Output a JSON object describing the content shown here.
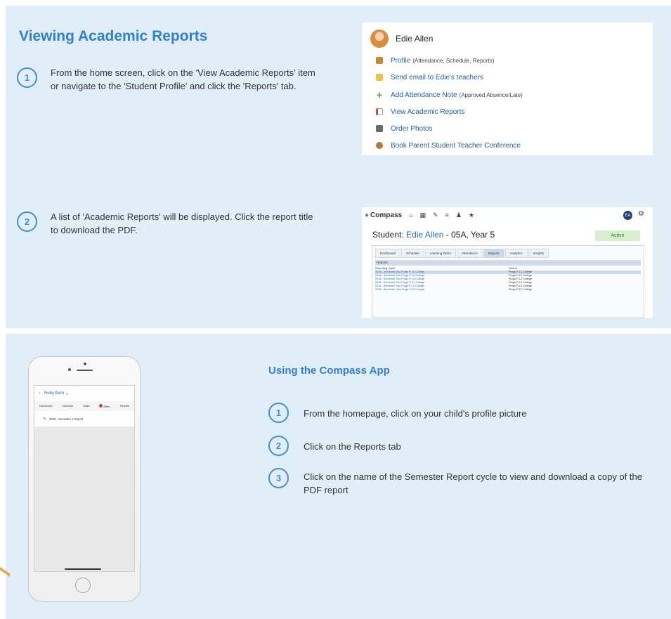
{
  "top": {
    "title": "Viewing Academic Reports",
    "step1": {
      "number": "1",
      "text": "From the home screen, click on the 'View Academic Reports' item or navigate to the 'Student Profile' and click the 'Reports' tab."
    },
    "step2": {
      "number": "2",
      "text": "A list of 'Academic Reports' will be displayed. Click the report title to download the PDF."
    },
    "profile_card": {
      "name": "Edie Allen",
      "items": [
        {
          "label": "Profile",
          "sub": "(Attendance, Schedule, Reports)",
          "icon": "person-icon",
          "color": "#c58b26"
        },
        {
          "label": "Send email to Edie's teachers",
          "sub": "",
          "icon": "envelope-icon",
          "color": "#f0c040"
        },
        {
          "label": "Add Attendance Note",
          "sub": "(Approved Absence/Late)",
          "icon": "plus-icon",
          "color": "#49a63a"
        },
        {
          "label": "View Academic Reports",
          "sub": "",
          "icon": "report-icon",
          "color": "#c74a4a"
        },
        {
          "label": "Order Photos",
          "sub": "",
          "icon": "camera-icon",
          "color": "#6a6a6a"
        },
        {
          "label": "Book Parent Student Teacher Conference",
          "sub": "",
          "icon": "conference-icon",
          "color": "#b07a30"
        }
      ]
    },
    "compass_card": {
      "logo": "Compass",
      "avatar_initials": "EA",
      "student_label": "Student:",
      "student_name": "Edie Allen",
      "student_detail": "- 05A, Year 5",
      "status": "Active",
      "tabs": [
        "Dashboard",
        "Schedule",
        "Learning Tasks",
        "Attendance",
        "Reports",
        "Analytics",
        "Insights"
      ],
      "active_tab": "Reports",
      "reports_header": "Reports",
      "columns": [
        "Reporting Cycle",
        "School"
      ],
      "rows": [
        {
          "cycle": "2018 - Semester Two Progs P-12 College",
          "school": "Progs P-12 College"
        },
        {
          "cycle": "2018 - Semester One Progs P-12 College",
          "school": "Progs P-12 College"
        },
        {
          "cycle": "2018 - Semester Two Progs P-12 College",
          "school": "Progs P-12 College"
        },
        {
          "cycle": "2018 - Semester One Progs P-12 College",
          "school": "Progs P-12 College"
        },
        {
          "cycle": "2016 - Semester Two Progs P-12 College",
          "school": "Progs P-12 College"
        },
        {
          "cycle": "2016 - Semester One Progs P-12 College",
          "school": "Progs P-12 College"
        }
      ]
    }
  },
  "bottom": {
    "title": "Using the Compass App",
    "steps": [
      {
        "number": "1",
        "text": "From the homepage, click on your child's profile picture"
      },
      {
        "number": "2",
        "text": "Click on the Reports tab"
      },
      {
        "number": "3",
        "text": "Click on the name of the Semester Report cycle to view and download a copy of the PDF report"
      }
    ],
    "phone": {
      "header": "Ruby Barn",
      "tabs": [
        "Dashboard",
        "Chronicle",
        "Tasks",
        "Atten.",
        "Reports"
      ],
      "report_item": "2020 - Semester 1 Report"
    }
  }
}
